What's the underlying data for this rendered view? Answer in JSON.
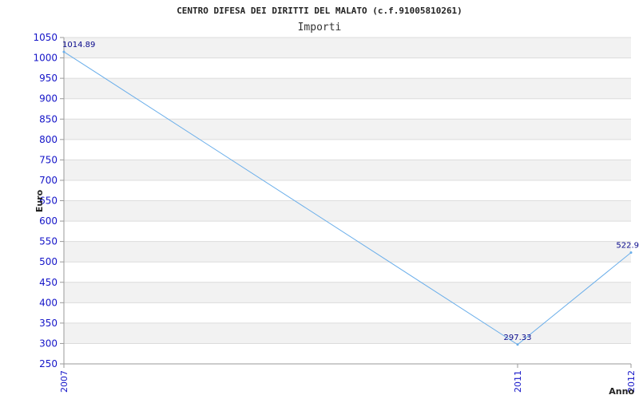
{
  "chart_data": {
    "type": "line",
    "title": "CENTRO DIFESA DEI DIRITTI DEL MALATO (c.f.91005810261)",
    "subtitle": "Importi",
    "xlabel": "Anno",
    "ylabel": "Euro",
    "categories": [
      "2007",
      "2011",
      "2012"
    ],
    "series": [
      {
        "values": [
          1014.89,
          297.33,
          522.9
        ],
        "labels": [
          "1014.89",
          "297.33",
          "522.9"
        ]
      }
    ],
    "ylim": [
      250,
      1050
    ],
    "yticks": [
      250,
      300,
      350,
      400,
      450,
      500,
      550,
      600,
      650,
      700,
      750,
      800,
      850,
      900,
      950,
      1000,
      1050
    ],
    "grid": true,
    "line_color": "#6aaeea",
    "tick_color": "#1515c8",
    "label_color": "#0a0a8c",
    "band_color": "#f2f2f2"
  }
}
